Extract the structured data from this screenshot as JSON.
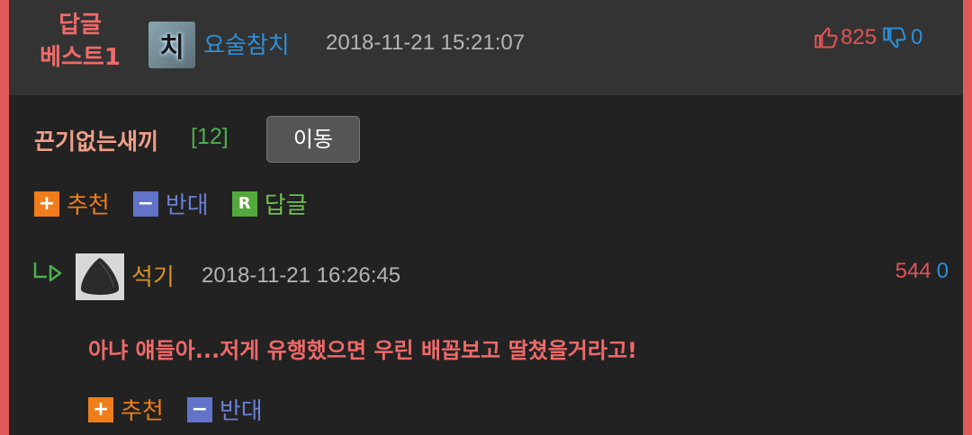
{
  "best_label": [
    "답글",
    "베스트1"
  ],
  "main": {
    "avatar_text": "치",
    "author": "요술참치",
    "date": "2018-11-21 15:21:07",
    "upvotes": "825",
    "downvotes": "0",
    "comment": "끈기없는새끼",
    "reply_count": "[12]",
    "move_label": "이동",
    "actions": {
      "up": "추천",
      "down": "반대",
      "reply": "답글"
    },
    "icons": {
      "up": "thumbs-up-icon",
      "down": "thumbs-down-icon"
    }
  },
  "reply": {
    "author": "석기",
    "date": "2018-11-21 16:26:45",
    "upvotes": "544",
    "downvotes": "0",
    "text": "아냐 얘들아...저게 유행했으면 우린 배꼽보고 딸쳤을거라고!",
    "actions": {
      "up": "추천",
      "down": "반대"
    }
  },
  "colors": {
    "accent": "#e05a5a",
    "up": "#e05555",
    "down": "#2e8fd8"
  }
}
